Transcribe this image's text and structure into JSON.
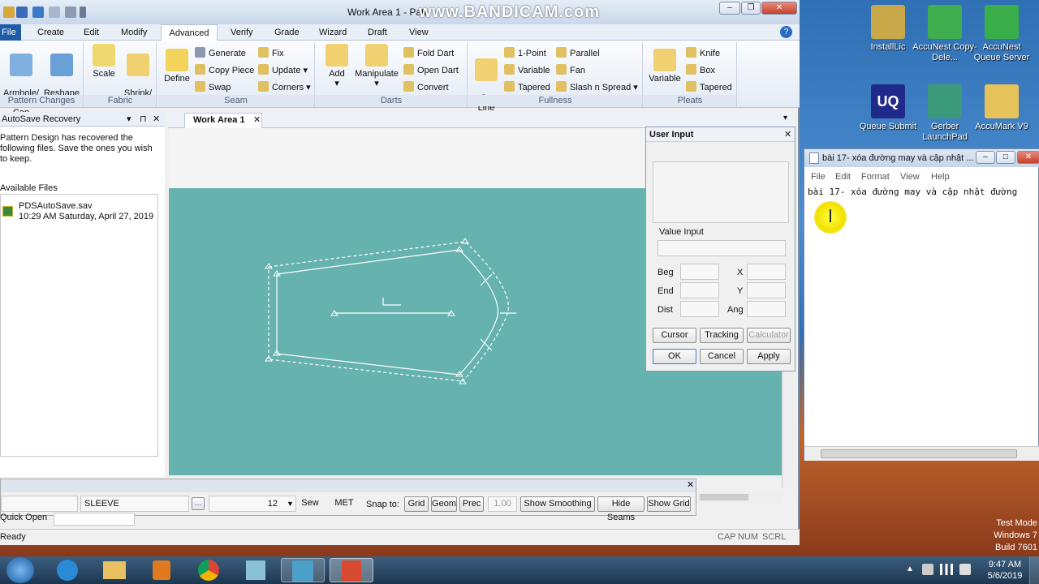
{
  "app": {
    "window_title": "Work Area 1 - Patt",
    "watermark": "www.BANDICAM.com",
    "menu_tabs": [
      "File",
      "Create",
      "Edit",
      "Modify",
      "Advanced",
      "Verify",
      "Grade",
      "Wizard",
      "Draft",
      "View"
    ],
    "help_glyph": "?"
  },
  "ribbon": {
    "pattern_changes": {
      "label": "Pattern Changes",
      "btn1": "Armhole/\nSleeve Cap",
      "btn2": "Reshape\nCurve"
    },
    "fabric": {
      "label": "Fabric",
      "btn1": "Scale",
      "btn2": "Shrink/\nStretch"
    },
    "seam": {
      "label": "Seam",
      "define": "Define",
      "generate": "Generate",
      "copy_piece": "Copy Piece",
      "swap": "Swap",
      "fix": "Fix",
      "update": "Update",
      "corners": "Corners"
    },
    "darts": {
      "label": "Darts",
      "add": "Add",
      "manipulate": "Manipulate",
      "fold_dart": "Fold Dart",
      "open_dart": "Open Dart",
      "convert": "Convert"
    },
    "fullness": {
      "label": "Fullness",
      "on_line": "On\nLine",
      "one_point": "1-Point",
      "variable": "Variable",
      "tapered": "Tapered",
      "parallel": "Parallel",
      "fan": "Fan",
      "slash_spread": "Slash n Spread"
    },
    "pleats": {
      "label": "Pleats",
      "variable": "Variable",
      "knife": "Knife",
      "box": "Box",
      "tapered": "Tapered"
    }
  },
  "autosave": {
    "title": "AutoSave Recovery",
    "message": "Pattern Design has recovered the following files. Save the ones you wish to keep.",
    "section": "Available Files",
    "file_name": "PDSAutoSave.sav",
    "file_date": "10:29 AM Saturday, April 27, 2019"
  },
  "work_area_tab": "Work Area 1",
  "user_input": {
    "title": "User Input",
    "value_input_label": "Value Input",
    "beg": "Beg",
    "end": "End",
    "dist": "Dist",
    "x": "X",
    "y": "Y",
    "ang": "Ang",
    "cursor": "Cursor",
    "tracking": "Tracking",
    "calculator": "Calculator",
    "ok": "OK",
    "cancel": "Cancel",
    "apply": "Apply"
  },
  "bottom_toolbar": {
    "piece_name": "SLEEVE",
    "browse": "...",
    "size": "12",
    "sew": "Sew",
    "units": "MET",
    "snap_to": "Snap to:",
    "grid": "Grid",
    "geom": "Geom",
    "prec": "Prec",
    "prec_value": "1.00",
    "show_smoothing": "Show Smoothing",
    "hide_seams": "Hide Seams",
    "show_grid": "Show Grid",
    "quick_open": "Quick Open"
  },
  "status": {
    "text": "Ready",
    "cap": "CAP",
    "num": "NUM",
    "scrl": "SCRL"
  },
  "desktop_icons": [
    {
      "label": "InstallLic",
      "color": "#7a6a2a"
    },
    {
      "label": "AccuNest Copy-Dele...",
      "color": "#2d8a3a"
    },
    {
      "label": "AccuNest Queue Server",
      "color": "#1a6aa8"
    },
    {
      "label": "Queue Submit",
      "color": "#2a2f8a"
    },
    {
      "label": "Gerber LaunchPad",
      "color": "#2a8a6a"
    },
    {
      "label": "AccuMark V9",
      "color": "#e0c060"
    }
  ],
  "notepad": {
    "title": "bài 17- xóa đường may và cập nhật ...",
    "menu": [
      "File",
      "Edit",
      "Format",
      "View",
      "Help"
    ],
    "text": "bài 17- xóa đường may và cập nhật đường"
  },
  "watermark_os": {
    "line1": "Test Mode",
    "line2": "Windows 7",
    "line3": "Build 7601"
  },
  "tray": {
    "time": "9:47 AM",
    "date": "5/6/2019"
  },
  "colors": {
    "canvas": "#66b2ae",
    "ribbon_accent": "#1f5ca8"
  }
}
